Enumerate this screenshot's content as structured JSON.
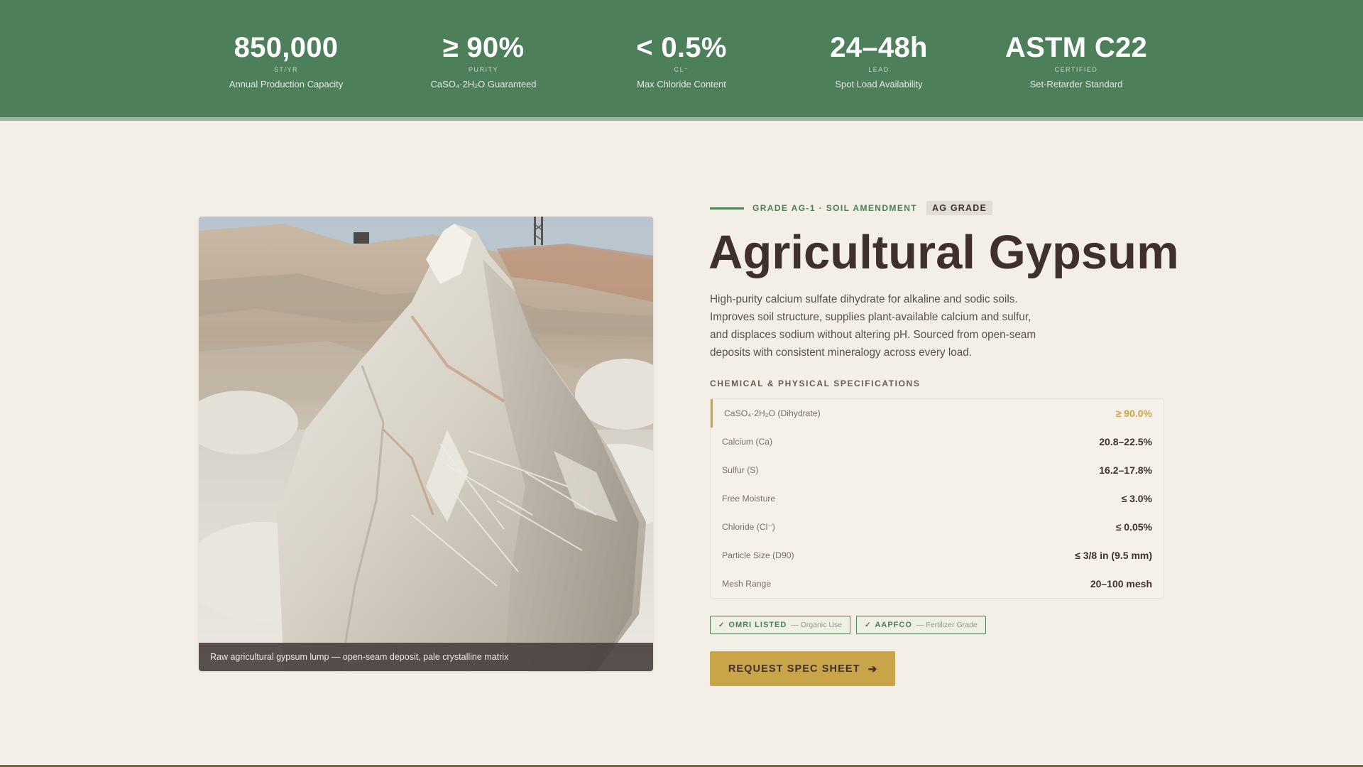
{
  "stats": [
    {
      "value": "850,000",
      "unit": "ST/YR",
      "label": "Annual Production Capacity"
    },
    {
      "value": "≥ 90%",
      "unit": "PURITY",
      "label": "CaSO₄·2H₂O Guaranteed"
    },
    {
      "value": "< 0.5%",
      "unit": "CL⁻",
      "label": "Max Chloride Content"
    },
    {
      "value": "24–48h",
      "unit": "LEAD",
      "label": "Spot Load Availability"
    },
    {
      "value": "ASTM C22",
      "unit": "CERTIFIED",
      "label": "Set-Retarder Standard"
    }
  ],
  "photo": {
    "caption": "Raw agricultural gypsum lump — open-seam deposit, pale crystalline matrix"
  },
  "product": {
    "eyebrow": "GRADE AG-1 · SOIL AMENDMENT",
    "badge": "AG GRADE",
    "title": "Agricultural Gypsum",
    "description": "High-purity calcium sulfate dihydrate for alkaline and sodic soils. Improves soil structure, supplies plant-available calcium and sulfur, and displaces sodium without altering pH. Sourced from open-seam deposits with consistent mineralogy across every load."
  },
  "specs": {
    "heading": "CHEMICAL & PHYSICAL SPECIFICATIONS",
    "rows": [
      {
        "label": "CaSO₄·2H₂O (Dihydrate)",
        "value": "≥ 90.0%"
      },
      {
        "label": "Calcium (Ca)",
        "value": "20.8–22.5%"
      },
      {
        "label": "Sulfur (S)",
        "value": "16.2–17.8%"
      },
      {
        "label": "Free Moisture",
        "value": "≤ 3.0%"
      },
      {
        "label": "Chloride (Cl⁻)",
        "value": "≤ 0.05%"
      },
      {
        "label": "Particle Size (D90)",
        "value": "≤ 3/8 in (9.5 mm)"
      },
      {
        "label": "Mesh Range",
        "value": "20–100 mesh"
      }
    ]
  },
  "certifications": [
    {
      "check": "✓",
      "name": "OMRI LISTED",
      "note": "— Organic Use"
    },
    {
      "check": "✓",
      "name": "AAPFCO",
      "note": "— Fertilizer Grade"
    }
  ],
  "cta": {
    "label": "REQUEST SPEC SHEET",
    "arrow": "➔"
  },
  "colors": {
    "band_green": "#4d7f5a",
    "background_cream": "#f3efe6",
    "accent_gold": "#c9a54a",
    "text_dark": "#3f302d"
  },
  "icons": [
    "check-icon",
    "arrow-right-icon"
  ]
}
